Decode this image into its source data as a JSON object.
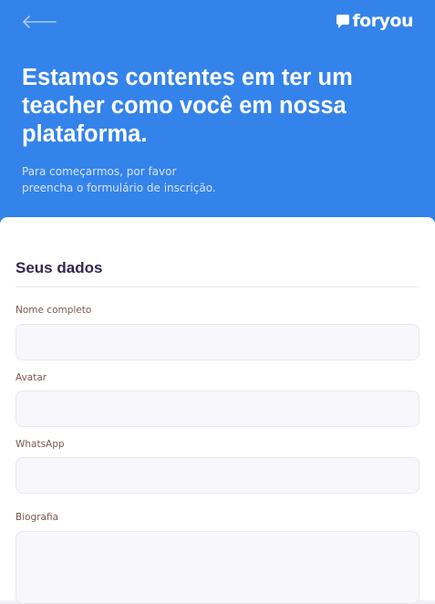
{
  "header": {
    "logo_text": "foryou",
    "title": "Estamos contentes em ter um teacher como você em nossa plataforma.",
    "subtitle_line1": "Para começarmos, por favor",
    "subtitle_line2": "preencha o formulário de inscrição."
  },
  "form": {
    "section_title": "Seus dados",
    "fields": [
      {
        "label": "Nome completo",
        "value": ""
      },
      {
        "label": "Avatar",
        "value": ""
      },
      {
        "label": "WhatsApp",
        "value": ""
      },
      {
        "label": "Biografia",
        "value": ""
      }
    ]
  },
  "colors": {
    "header_background": "#3483ea",
    "card_background": "#ffffff",
    "input_background": "#f8f8fc",
    "title_text": "#32264d"
  },
  "icons": {
    "back": "arrow-left-icon",
    "logo": "chat-bubble-icon"
  }
}
